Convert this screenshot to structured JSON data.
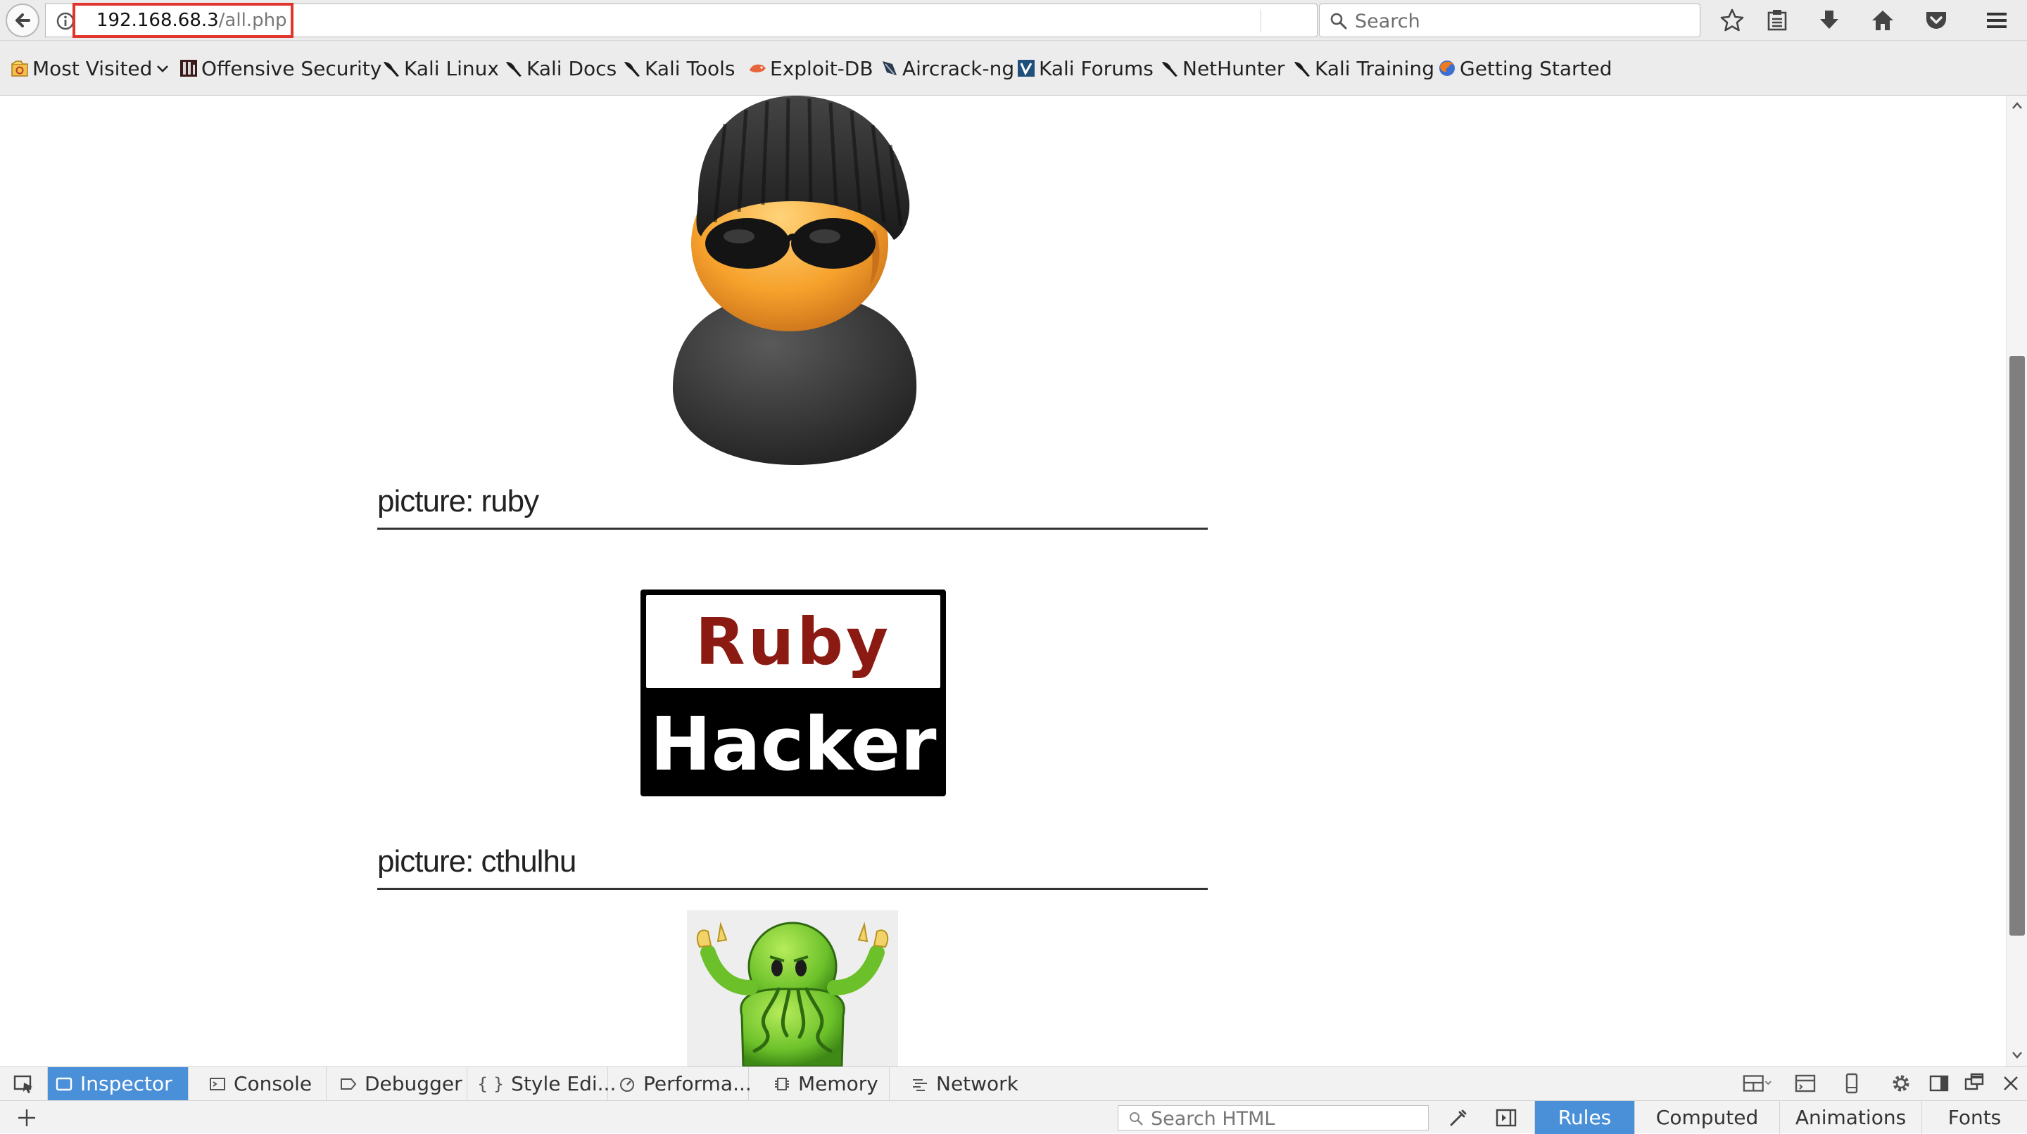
{
  "navbar": {
    "url_host": "192.168.68.3",
    "url_path": "/all.php",
    "search_placeholder": "Search"
  },
  "bookmarks": [
    {
      "label": "Most Visited",
      "icon": "most-visited-icon"
    },
    {
      "label": "Offensive Security",
      "icon": "offsec-icon"
    },
    {
      "label": "Kali Linux",
      "icon": "kali-dragon-icon"
    },
    {
      "label": "Kali Docs",
      "icon": "kali-dragon-icon"
    },
    {
      "label": "Kali Tools",
      "icon": "kali-dragon-icon"
    },
    {
      "label": "Exploit-DB",
      "icon": "exploit-db-icon"
    },
    {
      "label": "Aircrack-ng",
      "icon": "aircrack-icon"
    },
    {
      "label": "Kali Forums",
      "icon": "kali-forums-icon"
    },
    {
      "label": "NetHunter",
      "icon": "kali-dragon-icon"
    },
    {
      "label": "Kali Training",
      "icon": "kali-dragon-icon"
    },
    {
      "label": "Getting Started",
      "icon": "firefox-icon"
    }
  ],
  "content": {
    "pictures": [
      {
        "title": "picture: ruby",
        "logo_top": "Ruby",
        "logo_bottom": "Hacker"
      },
      {
        "title": "picture: cthulhu"
      }
    ]
  },
  "devtools": {
    "tabs": [
      {
        "label": "Inspector",
        "active": true
      },
      {
        "label": "Console"
      },
      {
        "label": "Debugger"
      },
      {
        "label": "Style Edi..."
      },
      {
        "label": "Performa..."
      },
      {
        "label": "Memory"
      },
      {
        "label": "Network"
      }
    ],
    "search_html_placeholder": "Search HTML",
    "side_tabs": [
      {
        "label": "Rules",
        "active": true
      },
      {
        "label": "Computed"
      },
      {
        "label": "Animations"
      },
      {
        "label": "Fonts"
      }
    ]
  },
  "colors": {
    "highlight_box": "#e0342c",
    "devtools_active": "#4a90d9",
    "ruby_red": "#8b1a12"
  }
}
